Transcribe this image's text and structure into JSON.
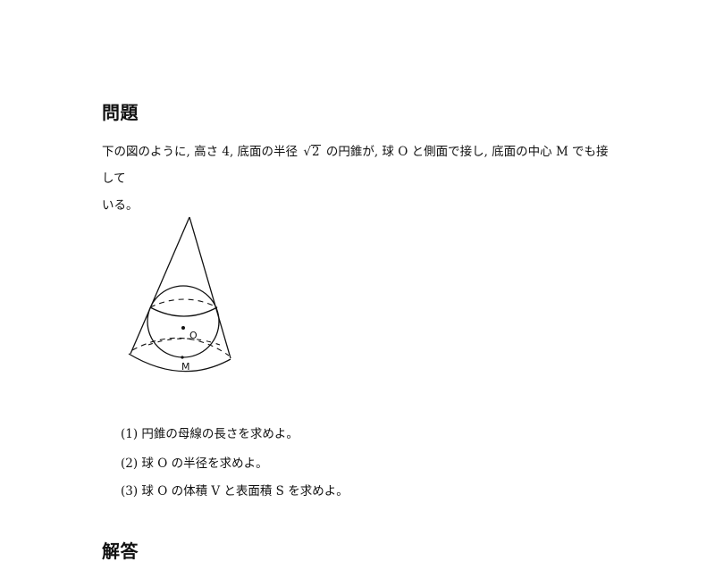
{
  "problem_heading": "問題",
  "intro": {
    "before_sqrt": "下の図のように, 高さ 4, 底面の半径 ",
    "sqrt_symbol": "√",
    "sqrt_radicand": "2",
    "after_sqrt": " の円錐が, 球 O と側面で接し, 底面の中心 M でも接して",
    "line2": "いる。"
  },
  "figure": {
    "label_center": "O",
    "label_base": "M"
  },
  "questions": [
    "(1) 円錐の母線の長さを求めよ。",
    "(2) 球 O の半径を求めよ。",
    "(3) 球 O の体積 V と表面積 S を求めよ。"
  ],
  "answer_heading": "解答"
}
